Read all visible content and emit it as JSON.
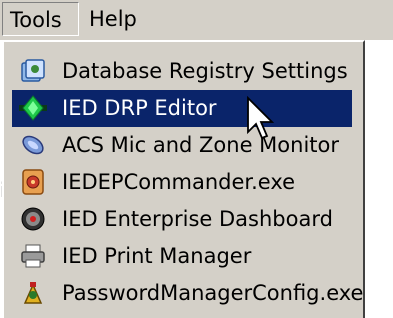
{
  "menubar": {
    "tools_label": "Tools",
    "help_label": "Help"
  },
  "menu": {
    "items": [
      {
        "label": "Database Registry Settings",
        "icon": "registry-icon"
      },
      {
        "label": "IED DRP Editor",
        "icon": "green-diamond-icon",
        "highlighted": true
      },
      {
        "label": "ACS Mic and Zone Monitor",
        "icon": "mic-monitor-icon"
      },
      {
        "label": "IEDEPCommander.exe",
        "icon": "commander-icon"
      },
      {
        "label": "IED Enterprise Dashboard",
        "icon": "dashboard-icon"
      },
      {
        "label": "IED Print Manager",
        "icon": "printer-icon"
      },
      {
        "label": "PasswordManagerConfig.exe",
        "icon": "password-config-icon"
      }
    ]
  },
  "colors": {
    "menu_bg": "#d4d0c8",
    "highlight": "#0a246a"
  }
}
